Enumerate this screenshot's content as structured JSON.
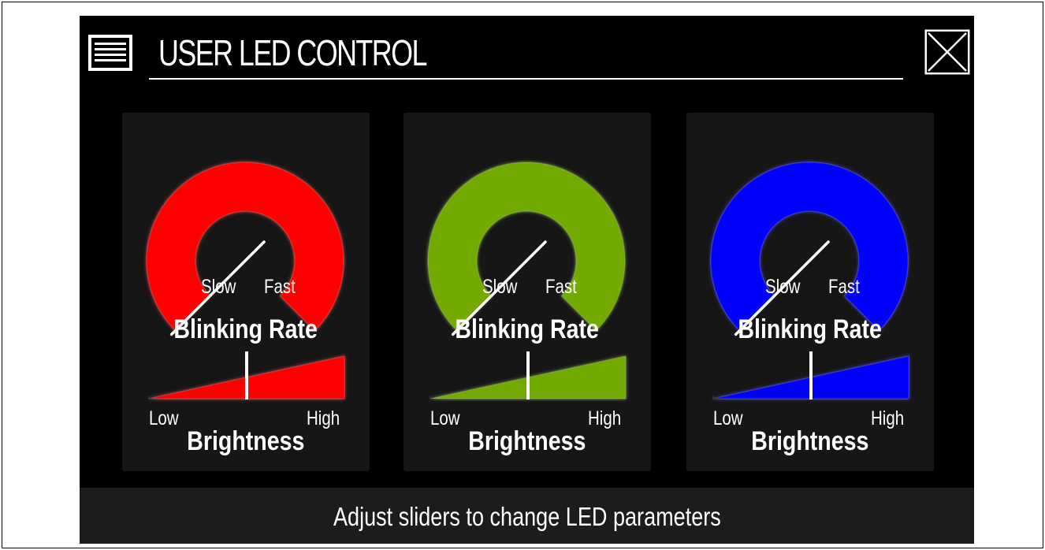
{
  "header": {
    "title": "USER LED CONTROL",
    "menu_icon": "hamburger-menu-icon",
    "close_icon": "close-x-icon"
  },
  "panels": [
    {
      "color_name": "red",
      "color": "#ff0000",
      "gauge": {
        "slow_label": "Slow",
        "fast_label": "Fast",
        "title": "Blinking Rate",
        "value": 0.0
      },
      "slider": {
        "low_label": "Low",
        "high_label": "High",
        "title": "Brightness",
        "value": 0.5
      }
    },
    {
      "color_name": "green",
      "color": "#73aa00",
      "gauge": {
        "slow_label": "Slow",
        "fast_label": "Fast",
        "title": "Blinking Rate",
        "value": 0.0
      },
      "slider": {
        "low_label": "Low",
        "high_label": "High",
        "title": "Brightness",
        "value": 0.5
      }
    },
    {
      "color_name": "blue",
      "color": "#0000ff",
      "gauge": {
        "slow_label": "Slow",
        "fast_label": "Fast",
        "title": "Blinking Rate",
        "value": 0.0
      },
      "slider": {
        "low_label": "Low",
        "high_label": "High",
        "title": "Brightness",
        "value": 0.5
      }
    }
  ],
  "footer": {
    "text": "Adjust sliders to change LED parameters"
  }
}
